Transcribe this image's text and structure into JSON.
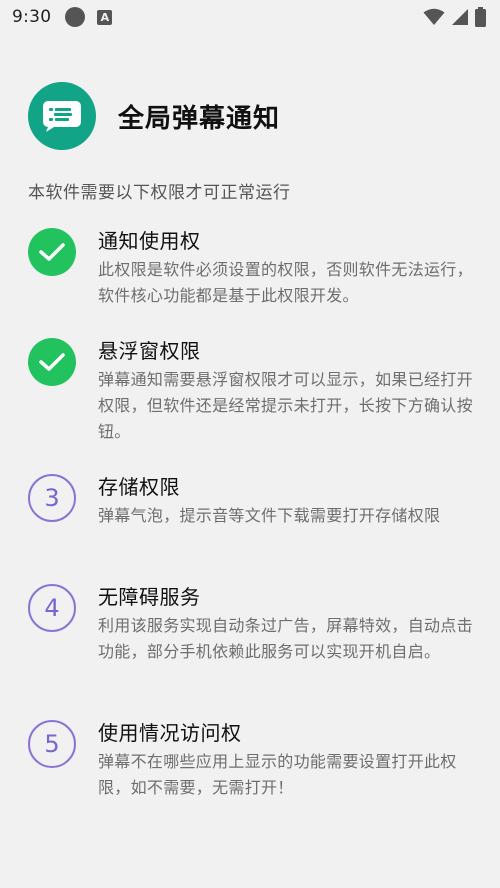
{
  "status_bar": {
    "time": "9:30",
    "notification_badge": "A",
    "icons": [
      "circle-notification-icon",
      "app-badge-icon",
      "wifi-icon",
      "signal-icon",
      "battery-icon"
    ]
  },
  "header": {
    "title": "全局弹幕通知",
    "logo_icon": "message-bubble-icon",
    "brand_color": "#11a487"
  },
  "intro": "本软件需要以下权限才可正常运行",
  "permissions": [
    {
      "state": "granted",
      "title": "通知使用权",
      "desc": "此权限是软件必须设置的权限，否则软件无法运行，软件核心功能都是基于此权限开发。"
    },
    {
      "state": "granted",
      "title": "悬浮窗权限",
      "desc": "弹幕通知需要悬浮窗权限才可以显示，如果已经打开权限，但软件还是经常提示未打开，长按下方确认按钮。"
    },
    {
      "state": "pending",
      "number": "3",
      "title": "存储权限",
      "desc": "弹幕气泡，提示音等文件下载需要打开存储权限"
    },
    {
      "state": "pending",
      "number": "4",
      "title": "无障碍服务",
      "desc": "利用该服务实现自动条过广告，屏幕特效，自动点击功能，部分手机依赖此服务可以实现开机自启。"
    },
    {
      "state": "pending",
      "number": "5",
      "title": "使用情况访问权",
      "desc": "弹幕不在哪些应用上显示的功能需要设置打开此权限，如不需要，无需打开！"
    }
  ],
  "colors": {
    "granted": "#22c35e",
    "pending": "#8b73d6"
  }
}
